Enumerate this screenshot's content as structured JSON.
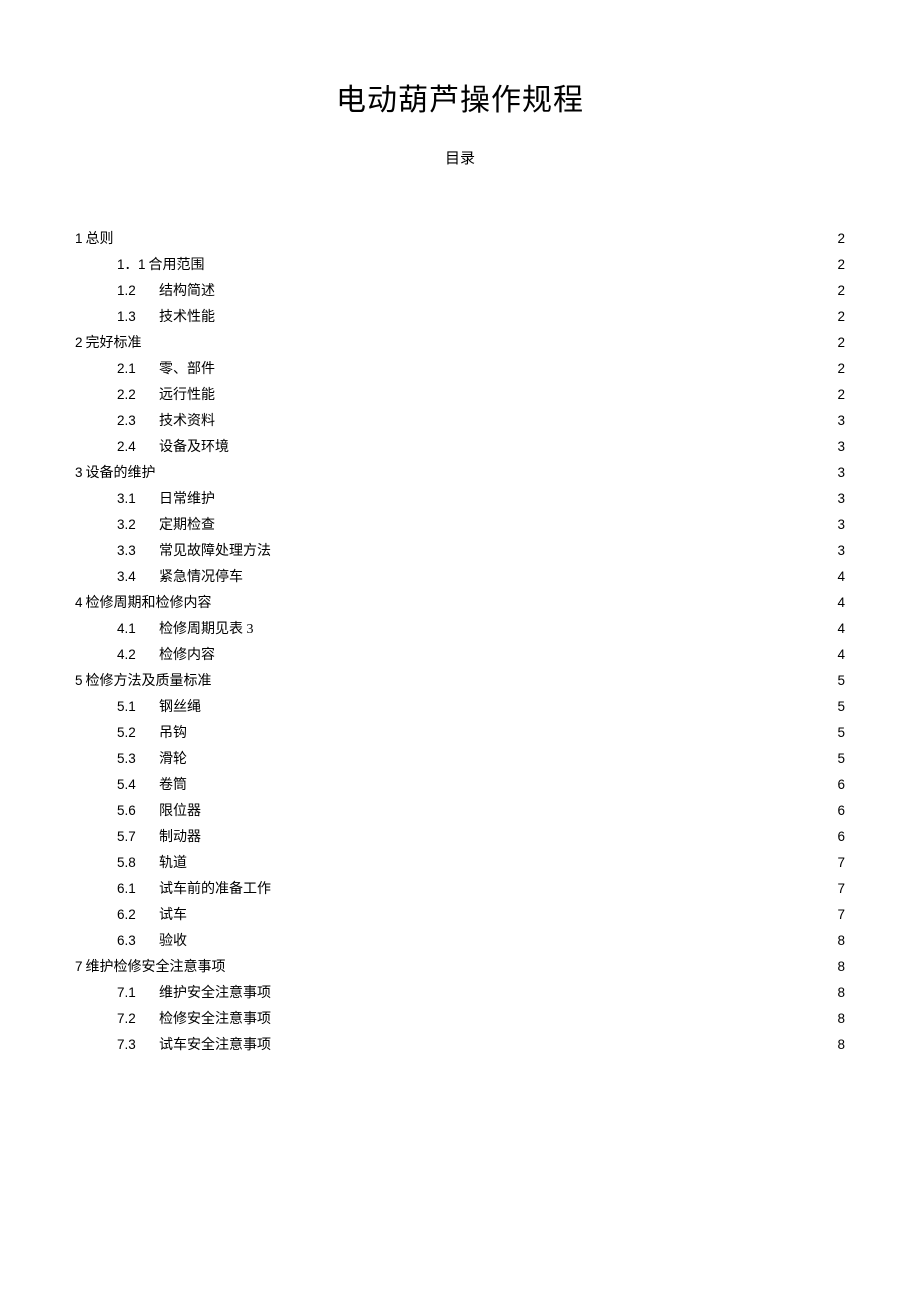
{
  "title": "电动葫芦操作规程",
  "subtitle": "目录",
  "toc": [
    {
      "level": 0,
      "num": "1",
      "label": "总则",
      "page": "2",
      "numStyle": "merged"
    },
    {
      "level": 1,
      "num": "1．1",
      "label": "合用范围",
      "page": "2",
      "numStyle": "merged"
    },
    {
      "level": 1,
      "num": "1.2",
      "label": "结构简述",
      "page": "2",
      "numStyle": "wide"
    },
    {
      "level": 1,
      "num": "1.3",
      "label": "技术性能",
      "page": "2",
      "numStyle": "wide"
    },
    {
      "level": 0,
      "num": "2",
      "label": "完好标准",
      "page": "2",
      "numStyle": "merged"
    },
    {
      "level": 1,
      "num": "2.1",
      "label": "零、部件",
      "page": "2",
      "numStyle": "wide"
    },
    {
      "level": 1,
      "num": "2.2",
      "label": "远行性能",
      "page": "2",
      "numStyle": "wide"
    },
    {
      "level": 1,
      "num": "2.3",
      "label": "技术资料",
      "page": "3",
      "numStyle": "wide"
    },
    {
      "level": 1,
      "num": "2.4",
      "label": "设备及环境",
      "page": "3",
      "numStyle": "wide"
    },
    {
      "level": 0,
      "num": "3",
      "label": "设备的维护",
      "page": "3",
      "numStyle": "merged"
    },
    {
      "level": 1,
      "num": "3.1",
      "label": "日常维护",
      "page": "3",
      "numStyle": "wide"
    },
    {
      "level": 1,
      "num": "3.2",
      "label": "定期检查",
      "page": "3",
      "numStyle": "wide"
    },
    {
      "level": 1,
      "num": "3.3",
      "label": "常见故障处理方法",
      "page": "3",
      "numStyle": "wide"
    },
    {
      "level": 1,
      "num": "3.4",
      "label": "紧急情况停车",
      "page": "4",
      "numStyle": "wide"
    },
    {
      "level": 0,
      "num": "4",
      "label": "检修周期和检修内容",
      "page": "4",
      "numStyle": "merged"
    },
    {
      "level": 1,
      "num": "4.1",
      "label": "检修周期见表 3",
      "page": "4",
      "numStyle": "wide"
    },
    {
      "level": 1,
      "num": "4.2",
      "label": "检修内容",
      "page": "4",
      "numStyle": "wide"
    },
    {
      "level": 0,
      "num": "5",
      "label": "检修方法及质量标准",
      "page": "5",
      "numStyle": "merged"
    },
    {
      "level": 1,
      "num": "5.1",
      "label": "钢丝绳",
      "page": "5",
      "numStyle": "wide"
    },
    {
      "level": 1,
      "num": "5.2",
      "label": "吊钩",
      "page": "5",
      "numStyle": "wide"
    },
    {
      "level": 1,
      "num": "5.3",
      "label": "滑轮",
      "page": "5",
      "numStyle": "wide"
    },
    {
      "level": 1,
      "num": "5.4",
      "label": "卷筒",
      "page": "6",
      "numStyle": "wide"
    },
    {
      "level": 1,
      "num": "5.6",
      "label": "限位器",
      "page": "6",
      "numStyle": "wide"
    },
    {
      "level": 1,
      "num": "5.7",
      "label": "制动器",
      "page": "6",
      "numStyle": "wide"
    },
    {
      "level": 1,
      "num": "5.8",
      "label": "轨道",
      "page": "7",
      "numStyle": "wide"
    },
    {
      "level": 1,
      "num": "6.1",
      "label": "试车前的准备工作",
      "page": "7",
      "numStyle": "wide"
    },
    {
      "level": 1,
      "num": "6.2",
      "label": "试车",
      "page": "7",
      "numStyle": "wide"
    },
    {
      "level": 1,
      "num": "6.3",
      "label": "验收",
      "page": "8",
      "numStyle": "wide"
    },
    {
      "level": 0,
      "num": "7",
      "label": "维护检修安全注意事项",
      "page": "8",
      "numStyle": "merged"
    },
    {
      "level": 1,
      "num": "7.1",
      "label": "维护安全注意事项",
      "page": "8",
      "numStyle": "wide"
    },
    {
      "level": 1,
      "num": "7.2",
      "label": "检修安全注意事项",
      "page": "8",
      "numStyle": "wide"
    },
    {
      "level": 1,
      "num": "7.3",
      "label": "试车安全注意事项",
      "page": "8",
      "numStyle": "wide"
    }
  ]
}
